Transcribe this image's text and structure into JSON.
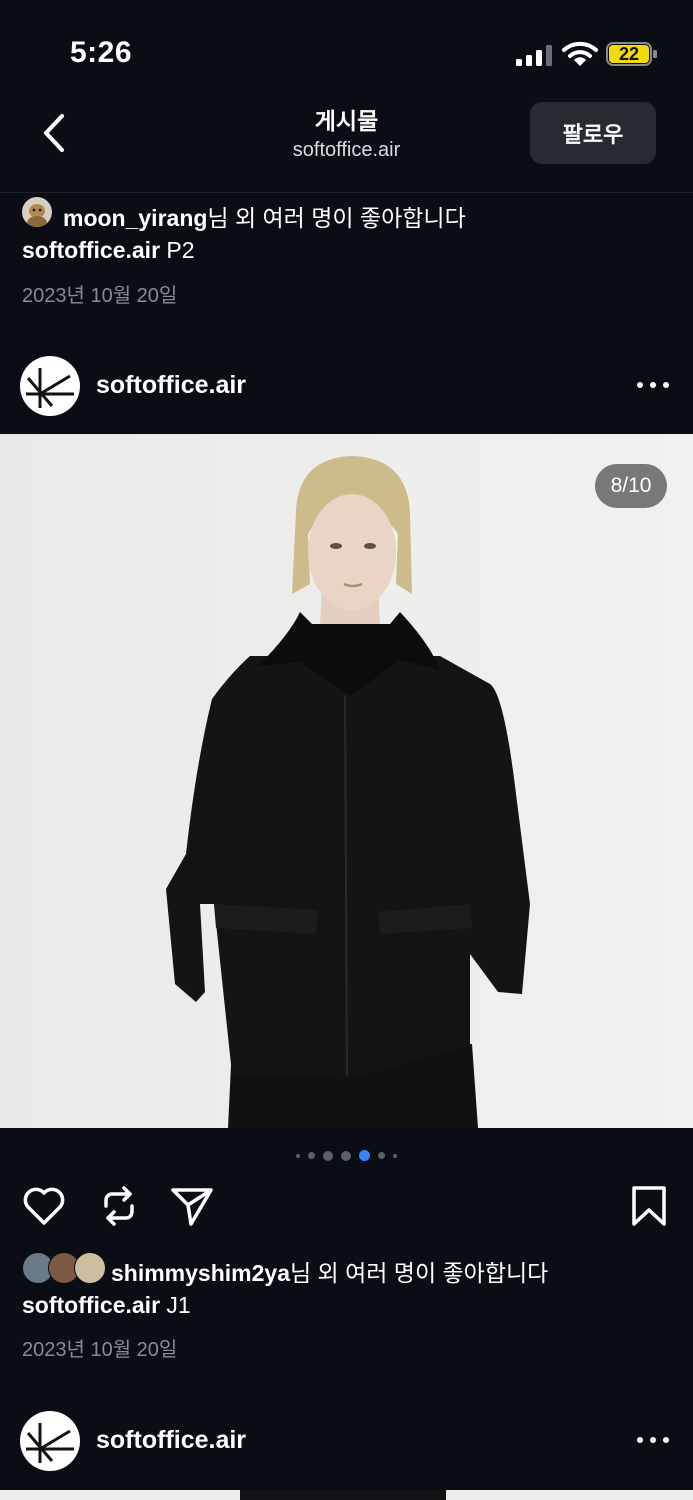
{
  "status_bar": {
    "time": "5:26",
    "battery": "22"
  },
  "header": {
    "title": "게시물",
    "subtitle": "softoffice.air",
    "follow_label": "팔로우"
  },
  "post1": {
    "liked_by_user": "moon_yirang",
    "liked_suffix": "님 외 여러 명이 좋아합니다",
    "caption_user": "softoffice.air",
    "caption_text": " P2",
    "date": "2023년 10월 20일"
  },
  "post2": {
    "username": "softoffice.air",
    "counter": "8/10",
    "carousel_active_index": 4,
    "liked_by_user": "shimmyshim2ya",
    "liked_suffix": "님 외 여러 명이 좋아합니다",
    "caption_user": "softoffice.air",
    "caption_text": " J1",
    "date": "2023년 10월 20일"
  },
  "post3": {
    "username": "softoffice.air"
  },
  "colors": {
    "background": "#0b0d14",
    "accent": "#3b82f6",
    "button": "#262a31"
  },
  "icons": [
    "back-chevron-icon",
    "signal-icon",
    "wifi-icon",
    "battery-icon",
    "more-icon",
    "heart-icon",
    "repost-icon",
    "send-icon",
    "bookmark-icon"
  ]
}
